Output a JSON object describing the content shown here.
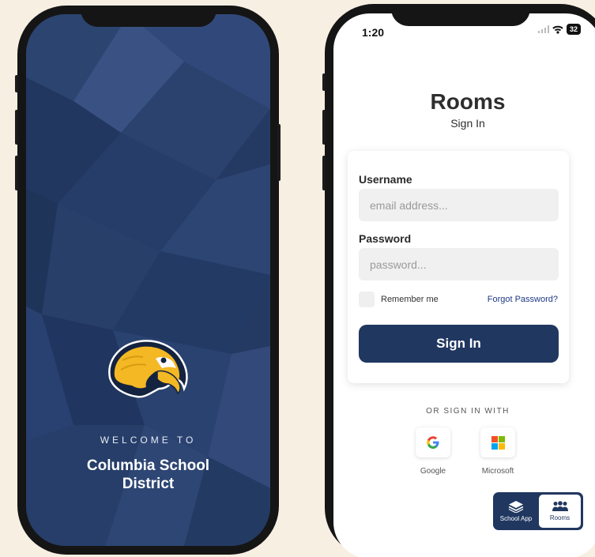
{
  "splash": {
    "welcome": "WELCOME TO",
    "district_line1": "Columbia School",
    "district_line2": "District",
    "logo": "eagle-mascot-logo",
    "colors": {
      "background": "#243a63",
      "logo_gold": "#f4b824"
    }
  },
  "status_bar": {
    "time": "1:20",
    "battery": "32",
    "icons": [
      "signal-icon",
      "wifi-icon",
      "battery-icon"
    ]
  },
  "header": {
    "title": "Rooms",
    "subtitle": "Sign In"
  },
  "form": {
    "username_label": "Username",
    "username_placeholder": "email address...",
    "password_label": "Password",
    "password_placeholder": "password...",
    "remember_label": "Remember me",
    "forgot_label": "Forgot Password?",
    "signin_label": "Sign In"
  },
  "social": {
    "heading": "OR SIGN IN WITH",
    "google_label": "Google",
    "microsoft_label": "Microsoft"
  },
  "app_switch": {
    "school_label": "School App",
    "rooms_label": "Rooms",
    "selected": "Rooms"
  },
  "colors": {
    "primary": "#203760",
    "link": "#1f3a86",
    "page_background": "#f8efe3"
  }
}
